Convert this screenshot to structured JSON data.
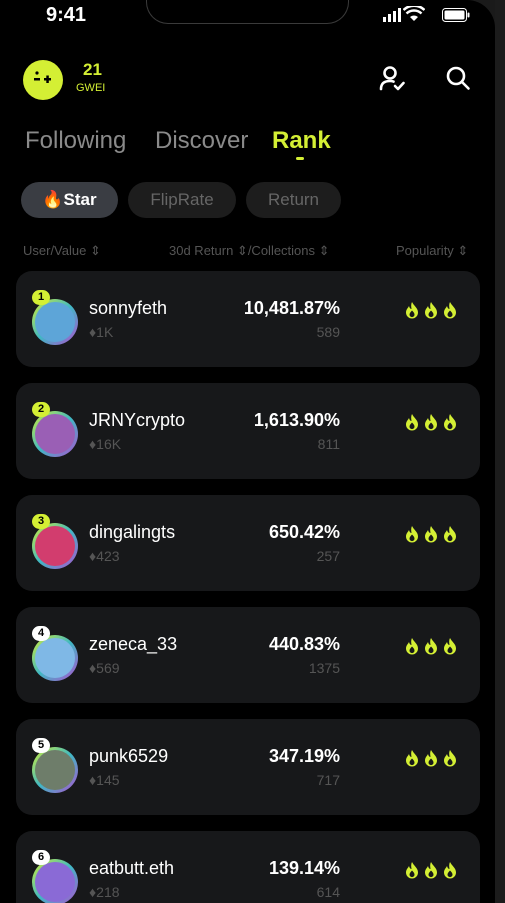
{
  "status_bar": {
    "time": "9:41"
  },
  "header": {
    "gas_value": "21",
    "gas_unit": "GWEI"
  },
  "tabs": [
    "Following",
    "Discover",
    "Rank"
  ],
  "filters": {
    "star_emoji": "🔥",
    "star": "Star",
    "fliprate": "FlipRate",
    "return": "Return"
  },
  "columns": {
    "user": "User/Value ⇕",
    "return": "30d Return ⇕/Collections ⇕",
    "popularity": "Popularity ⇕"
  },
  "rows": [
    {
      "rank": "1",
      "name": "sonnyfeth",
      "value": "1K",
      "return": "10,481.87%",
      "collections": "589",
      "avatar_color": "#5da5d8"
    },
    {
      "rank": "2",
      "name": "JRNYcrypto",
      "value": "16K",
      "return": "1,613.90%",
      "collections": "811",
      "avatar_color": "#9a5fb5"
    },
    {
      "rank": "3",
      "name": "dingalingts",
      "value": "423",
      "return": "650.42%",
      "collections": "257",
      "avatar_color": "#d23d6e"
    },
    {
      "rank": "4",
      "name": "zeneca_33",
      "value": "569",
      "return": "440.83%",
      "collections": "1375",
      "avatar_color": "#7fb8e6"
    },
    {
      "rank": "5",
      "name": "punk6529",
      "value": "145",
      "return": "347.19%",
      "collections": "717",
      "avatar_color": "#6e7d6a"
    },
    {
      "rank": "6",
      "name": "eatbutt.eth",
      "value": "218",
      "return": "139.14%",
      "collections": "614",
      "avatar_color": "#8a6ad6"
    }
  ],
  "colors": {
    "accent": "#d4ef34",
    "card": "#17181a",
    "muted": "#555555"
  },
  "icons": {
    "header": [
      "user-check-icon",
      "search-icon"
    ],
    "popularity": "flame-icon",
    "value": "eth-icon"
  }
}
